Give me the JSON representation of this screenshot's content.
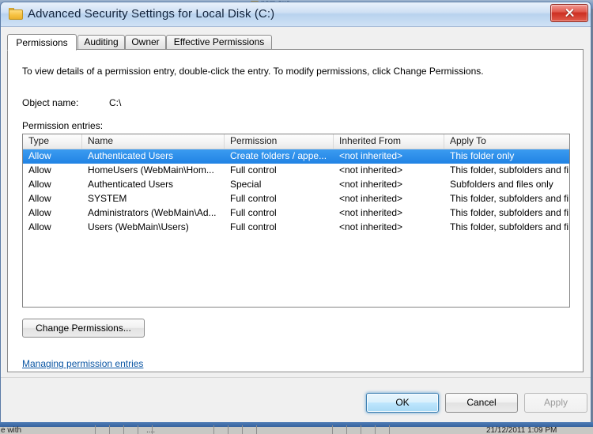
{
  "window": {
    "title": "Advanced Security Settings for Local Disk (C:)",
    "icon": "folder-icon",
    "close_label": "Close"
  },
  "tabs": [
    {
      "label": "Permissions",
      "active": true
    },
    {
      "label": "Auditing",
      "active": false
    },
    {
      "label": "Owner",
      "active": false
    },
    {
      "label": "Effective Permissions",
      "active": false
    }
  ],
  "panel": {
    "description": "To view details of a permission entry, double-click the entry. To modify permissions, click Change Permissions.",
    "object_name_label": "Object name:",
    "object_name_value": "C:\\",
    "permission_entries_label": "Permission entries:"
  },
  "table": {
    "columns": [
      "Type",
      "Name",
      "Permission",
      "Inherited From",
      "Apply To"
    ],
    "rows": [
      {
        "type": "Allow",
        "name": "Authenticated Users",
        "permission": "Create folders / appe...",
        "inherited_from": "<not inherited>",
        "apply_to": "This folder only",
        "selected": true
      },
      {
        "type": "Allow",
        "name": "HomeUsers (WebMain\\Hom...",
        "permission": "Full control",
        "inherited_from": "<not inherited>",
        "apply_to": "This folder, subfolders and fil...",
        "selected": false
      },
      {
        "type": "Allow",
        "name": "Authenticated Users",
        "permission": "Special",
        "inherited_from": "<not inherited>",
        "apply_to": "Subfolders and files only",
        "selected": false
      },
      {
        "type": "Allow",
        "name": "SYSTEM",
        "permission": "Full control",
        "inherited_from": "<not inherited>",
        "apply_to": "This folder, subfolders and fil...",
        "selected": false
      },
      {
        "type": "Allow",
        "name": "Administrators (WebMain\\Ad...",
        "permission": "Full control",
        "inherited_from": "<not inherited>",
        "apply_to": "This folder, subfolders and fil...",
        "selected": false
      },
      {
        "type": "Allow",
        "name": "Users (WebMain\\Users)",
        "permission": "Full control",
        "inherited_from": "<not inherited>",
        "apply_to": "This folder, subfolders and fil...",
        "selected": false
      }
    ]
  },
  "actions": {
    "change_permissions": "Change Permissions...",
    "managing_link": "Managing permission entries",
    "ok": "OK",
    "cancel": "Cancel",
    "apply": "Apply"
  },
  "background": {
    "top_window_title": "nam exa",
    "bottom_left_text": "e with",
    "bottom_middle_text": "....",
    "bottom_right_text": "21/12/2011 1:09 PM"
  },
  "colors": {
    "selection": "#2183e4",
    "link": "#0b56a4",
    "close_button": "#cc2f22",
    "default_button_border": "#3c7fb1"
  }
}
